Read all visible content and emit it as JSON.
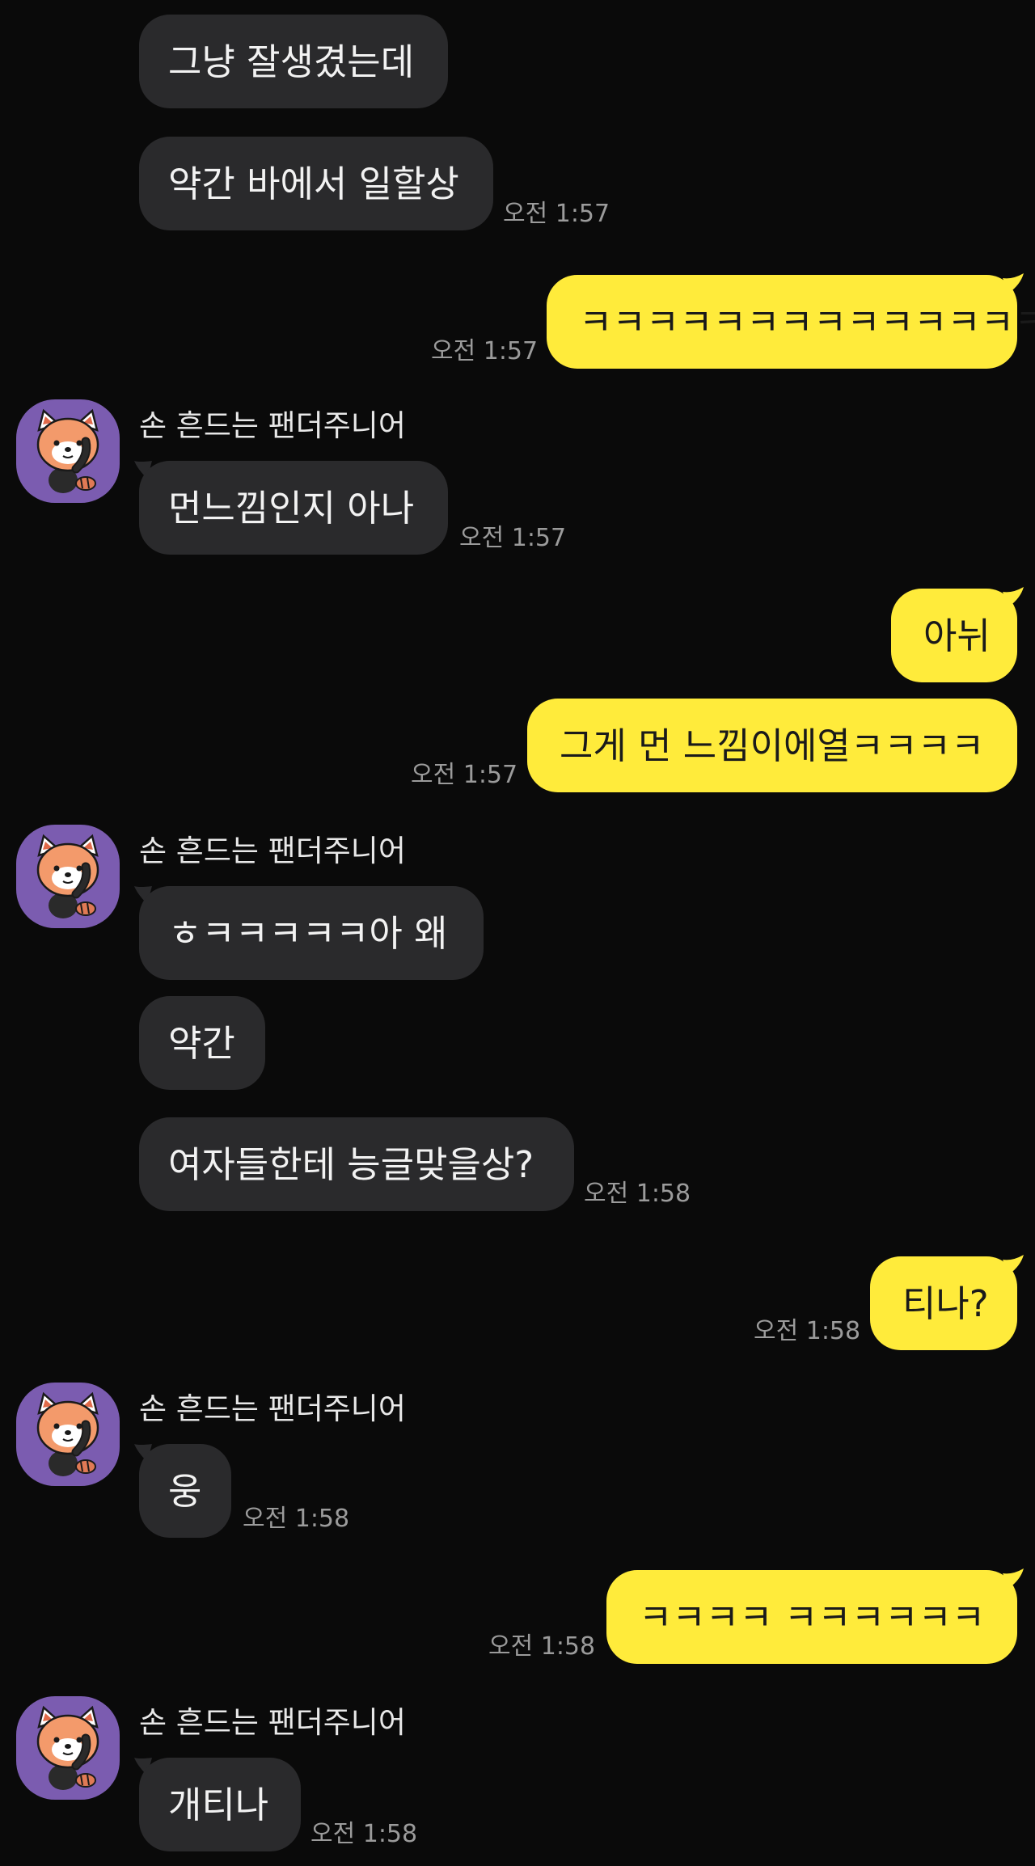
{
  "chat": {
    "sender_name": "손 흔드는 팬더주니어",
    "colors": {
      "background": "#0a0a0a",
      "incoming_bubble": "#2a2a2c",
      "outgoing_bubble": "#ffeb3b",
      "timestamp": "#9b9b9b"
    },
    "messages": [
      {
        "dir": "in",
        "text": "그냥 잘생겼는데"
      },
      {
        "dir": "in",
        "text": "약간 바에서 일할상",
        "time": "오전 1:57"
      },
      {
        "dir": "out",
        "text": "ㅋㅋㅋㅋㅋㅋㅋㅋㅋㅋㅋㅋㅋㅋ",
        "time": "오전 1:57"
      },
      {
        "dir": "in",
        "sender": "손 흔드는 팬더주니어",
        "text": "먼느낌인지 아나",
        "time": "오전 1:57"
      },
      {
        "dir": "out",
        "text": "아뉘"
      },
      {
        "dir": "out",
        "text": "그게 먼 느낌이에열ㅋㅋㅋㅋ",
        "time": "오전 1:57"
      },
      {
        "dir": "in",
        "sender": "손 흔드는 팬더주니어",
        "text": "ㅎㅋㅋㅋㅋㅋ아 왜"
      },
      {
        "dir": "in",
        "text": "약간"
      },
      {
        "dir": "in",
        "text": "여자들한테 능글맞을상?",
        "time": "오전 1:58"
      },
      {
        "dir": "out",
        "text": "티나?",
        "time": "오전 1:58"
      },
      {
        "dir": "in",
        "sender": "손 흔드는 팬더주니어",
        "text": "웅",
        "time": "오전 1:58"
      },
      {
        "dir": "out",
        "text": "ㅋㅋㅋㅋ ㅋㅋㅋㅋㅋㅋ",
        "time": "오전 1:58"
      },
      {
        "dir": "in",
        "sender": "손 흔드는 팬더주니어",
        "text": "개티나",
        "time": "오전 1:58"
      }
    ]
  }
}
